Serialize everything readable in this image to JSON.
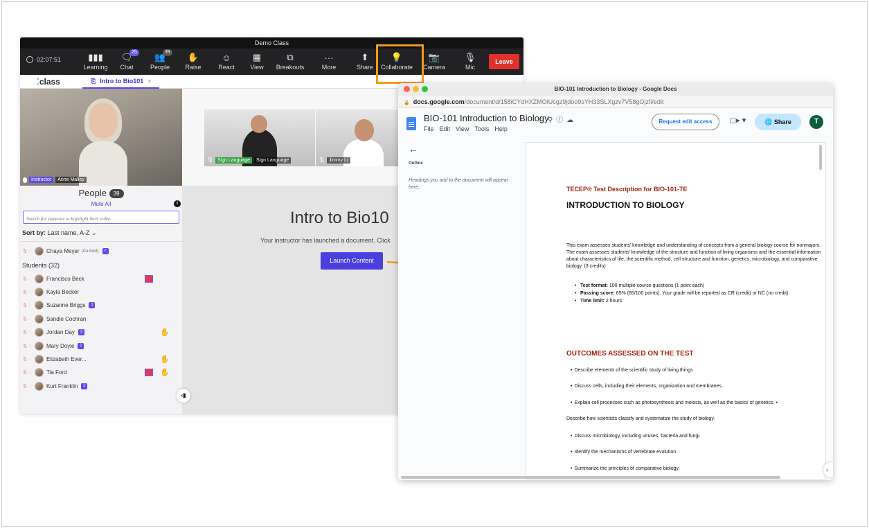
{
  "class_app": {
    "window_title": "Demo Class",
    "timer": "02:07:51",
    "toolbar": [
      {
        "label": "Learning",
        "icon": "chart-icon",
        "glyph": "▮▮▮"
      },
      {
        "label": "Chat",
        "icon": "chat-icon",
        "glyph": "🗨",
        "badge": "25"
      },
      {
        "label": "People",
        "icon": "people-icon",
        "glyph": "👥",
        "badge": "39"
      },
      {
        "label": "Raise",
        "icon": "hand-icon",
        "glyph": "✋"
      },
      {
        "label": "React",
        "icon": "smiley-icon",
        "glyph": "☺"
      },
      {
        "label": "View",
        "icon": "view-icon",
        "glyph": "▦"
      },
      {
        "label": "Breakouts",
        "icon": "breakouts-icon",
        "glyph": "⧉"
      },
      {
        "label": "More",
        "icon": "more-icon",
        "glyph": "···"
      },
      {
        "label": "Share",
        "icon": "share-icon",
        "glyph": "⬆"
      },
      {
        "label": "Collaborate",
        "icon": "lightbulb-icon",
        "glyph": "💡"
      },
      {
        "label": "Camera",
        "icon": "camera-off-icon",
        "glyph": "📷"
      },
      {
        "label": "Mic",
        "icon": "mic-off-icon",
        "glyph": "🎙"
      }
    ],
    "leave_label": "Leave",
    "logo_text": "class",
    "tab_label": "Intro to Bio101",
    "instructor_tag": "Instructor",
    "instructor_name": "Anne Malley",
    "people_title": "People",
    "people_count": "39",
    "mute_all": "Mute All",
    "search_placeholder": "Search for someone to highlight their video",
    "sort_label": "Sort by:",
    "sort_value": "Last name, A-Z",
    "cohost_name": "Chaya Meyer",
    "cohost_tag": "(Co-host)",
    "students_header": "Students (32)",
    "students": [
      {
        "name": "Francisco Beck",
        "badge": "",
        "heart": true,
        "hand": false
      },
      {
        "name": "Kayla Becker",
        "badge": "",
        "heart": false,
        "hand": false
      },
      {
        "name": "Suzanne Briggs",
        "badge": "1",
        "heart": false,
        "hand": false
      },
      {
        "name": "Sandie Cochran",
        "badge": "",
        "heart": false,
        "hand": false
      },
      {
        "name": "Jordan Day",
        "badge": "3",
        "heart": false,
        "hand": true
      },
      {
        "name": "Mary Doyle",
        "badge": "1",
        "heart": false,
        "hand": false
      },
      {
        "name": "Elizabeth Ever...",
        "badge": "",
        "heart": false,
        "hand": true
      },
      {
        "name": "Tia Ford",
        "badge": "",
        "heart": true,
        "hand": true
      },
      {
        "name": "Kurt Franklin",
        "badge": "2",
        "heart": false,
        "hand": false
      }
    ],
    "stage_thumbs": [
      {
        "tag": "Sign Language",
        "name": "Sign Language"
      },
      {
        "tag": "",
        "name": "Jimmy Li"
      }
    ],
    "main_title": "Intro to Bio10",
    "main_text": "Your instructor has launched a document. Click",
    "launch_button": "Launch Content"
  },
  "docs": {
    "window_title": "BIO-101 Introduction to Biology - Google Docs",
    "url_host": "docs.google.com",
    "url_path": "/document/d/158iCYdHXZMOiUcgz9jdoo9sYH33SLXgzv7V58gOjzfi/edit",
    "doc_name": "BIO-101 Introduction to Biology",
    "menu": [
      "File",
      "Edit",
      "View",
      "Tools",
      "Help"
    ],
    "request_edit": "Request edit access",
    "share": "Share",
    "avatar_letter": "T",
    "outline_label": "Outline",
    "outline_hint": "Headings you add to the document will appear here.",
    "subtitle": "TECEP® Test Description for BIO-101-TE",
    "heading": "INTRODUCTION TO BIOLOGY",
    "paragraph": "This exam assesses students' knowledge and understanding of concepts from a general biology course for nonmajors. The exam assesses students' knowledge of the structure and function of living organisms and the essential information about characteristics of life, the scientific method, cell structure and function, genetics, microbiology, and comparative biology. (3 credits)",
    "facts": [
      {
        "label": "Test format:",
        "text": " 100 multiple course questions (1 point each)"
      },
      {
        "label": "Passing score:",
        "text": " 65% (65/100 points). Your grade will be reported as CR (credit) or NC (no credit)."
      },
      {
        "label": "Time limit:",
        "text": " 2 hours"
      }
    ],
    "outcomes_heading": "OUTCOMES ASSESSED ON THE TEST",
    "outcomes": [
      "Describe elements of the scientific study of living things",
      "Discuss cells, including their elements, organization and membranes.",
      "Explain cell processes such as photosynthesis and meiosis, as well as the basics of genetics. •",
      "Describe how scientists classify and systematize the study of biology.",
      "Discuss microbiology, including viruses, bacteria and fungi.",
      "Identify the mechanisms of vertebrate evolution.",
      "Summarize the principles of comparative biology."
    ]
  },
  "colors": {
    "accent": "#5546e8",
    "highlight": "#f29a1a",
    "leave": "#e0312f",
    "doc_red": "#a3230e"
  }
}
